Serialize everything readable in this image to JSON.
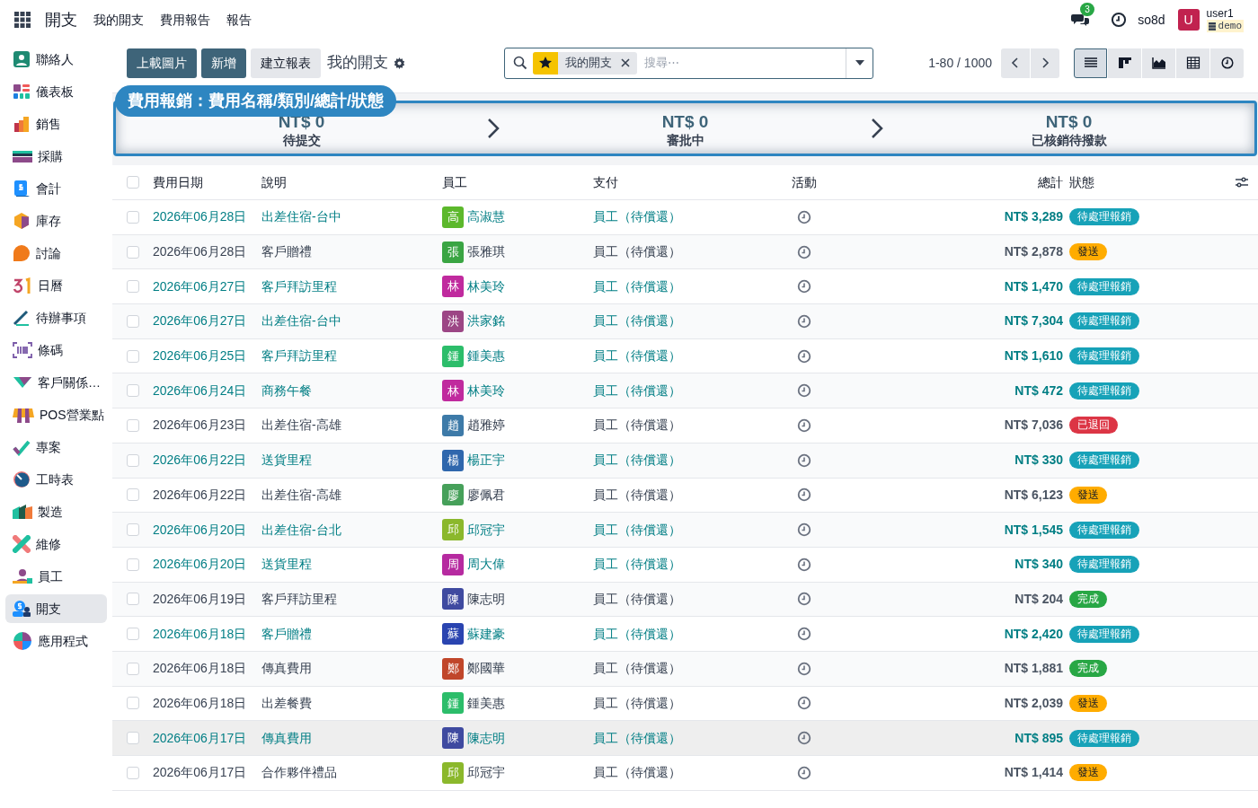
{
  "topbar": {
    "app_title": "開支",
    "menu": [
      "我的開支",
      "費用報告",
      "報告"
    ],
    "messages_count": "3",
    "company": "so8d",
    "user_initial": "U",
    "user_name": "user1",
    "database": "demo"
  },
  "sidebar": {
    "items": [
      {
        "label": "聯絡人",
        "selected": false
      },
      {
        "label": "儀表板",
        "selected": false
      },
      {
        "label": "銷售",
        "selected": false
      },
      {
        "label": "採購",
        "selected": false
      },
      {
        "label": "會計",
        "selected": false
      },
      {
        "label": "庫存",
        "selected": false
      },
      {
        "label": "討論",
        "selected": false
      },
      {
        "label": "日曆",
        "selected": false
      },
      {
        "label": "待辦事項",
        "selected": false
      },
      {
        "label": "條碼",
        "selected": false
      },
      {
        "label": "客戶關係…",
        "selected": false
      },
      {
        "label": "POS營業點",
        "selected": false
      },
      {
        "label": "專案",
        "selected": false
      },
      {
        "label": "工時表",
        "selected": false
      },
      {
        "label": "製造",
        "selected": false
      },
      {
        "label": "維修",
        "selected": false
      },
      {
        "label": "員工",
        "selected": false
      },
      {
        "label": "開支",
        "selected": true
      },
      {
        "label": "應用程式",
        "selected": false
      }
    ]
  },
  "control_panel": {
    "buttons": [
      {
        "label": "上載圖片",
        "kind": "primary"
      },
      {
        "label": "新增",
        "kind": "primary"
      },
      {
        "label": "建立報表",
        "kind": "secondary"
      }
    ],
    "breadcrumb": "我的開支",
    "search": {
      "facet": "我的開支",
      "placeholder": "搜尋⋯"
    },
    "pager": "1-80 / 1000",
    "views": [
      {
        "selected": true
      },
      {
        "selected": false
      },
      {
        "selected": false
      },
      {
        "selected": false
      },
      {
        "selected": false
      }
    ]
  },
  "tooltip": "費用報銷：費用名稱/類別/總計/狀態",
  "stages": [
    {
      "amount": "NT$ 0",
      "label": "待提交"
    },
    {
      "amount": "NT$ 0",
      "label": "審批中"
    },
    {
      "amount": "NT$ 0",
      "label": "已核銷待撥款"
    }
  ],
  "table": {
    "select_all_checked": false,
    "columns": [
      "費用日期",
      "說明",
      "員工",
      "支付",
      "活動",
      "總計",
      "狀態"
    ],
    "rows": [
      {
        "checked": false,
        "highlighted": false,
        "date": "2026年06月28日",
        "description": "出差住宿-台中",
        "avatar": {
          "initial": "高",
          "color": "#5cb82c"
        },
        "employee": "高淑慧",
        "payment": "員工（待償還）",
        "total": "NT$ 3,289",
        "status": {
          "label": "待處理報銷",
          "kind": "approve"
        }
      },
      {
        "checked": false,
        "highlighted": false,
        "date": "2026年06月28日",
        "description": "客戶贈禮",
        "avatar": {
          "initial": "張",
          "color": "#3aa543"
        },
        "employee": "張雅琪",
        "payment": "員工（待償還）",
        "total": "NT$ 2,878",
        "status": {
          "label": "發送",
          "kind": "submitted"
        }
      },
      {
        "checked": false,
        "highlighted": false,
        "date": "2026年06月27日",
        "description": "客戶拜訪里程",
        "avatar": {
          "initial": "林",
          "color": "#c02a9e"
        },
        "employee": "林美玲",
        "payment": "員工（待償還）",
        "total": "NT$ 1,470",
        "status": {
          "label": "待處理報銷",
          "kind": "approve"
        }
      },
      {
        "checked": false,
        "highlighted": false,
        "date": "2026年06月27日",
        "description": "出差住宿-台中",
        "avatar": {
          "initial": "洪",
          "color": "#9c4685"
        },
        "employee": "洪家銘",
        "payment": "員工（待償還）",
        "total": "NT$ 7,304",
        "status": {
          "label": "待處理報銷",
          "kind": "approve"
        }
      },
      {
        "checked": false,
        "highlighted": false,
        "date": "2026年06月25日",
        "description": "客戶拜訪里程",
        "avatar": {
          "initial": "鍾",
          "color": "#2cbd6a"
        },
        "employee": "鍾美惠",
        "payment": "員工（待償還）",
        "total": "NT$ 1,610",
        "status": {
          "label": "待處理報銷",
          "kind": "approve"
        }
      },
      {
        "checked": false,
        "highlighted": false,
        "date": "2026年06月24日",
        "description": "商務午餐",
        "avatar": {
          "initial": "林",
          "color": "#c02a9e"
        },
        "employee": "林美玲",
        "payment": "員工（待償還）",
        "total": "NT$ 472",
        "status": {
          "label": "待處理報銷",
          "kind": "approve"
        }
      },
      {
        "checked": false,
        "highlighted": false,
        "date": "2026年06月23日",
        "description": "出差住宿-高雄",
        "avatar": {
          "initial": "趙",
          "color": "#3d7aa8"
        },
        "employee": "趙雅婷",
        "payment": "員工（待償還）",
        "total": "NT$ 7,036",
        "status": {
          "label": "已退回",
          "kind": "refused"
        }
      },
      {
        "checked": false,
        "highlighted": false,
        "date": "2026年06月22日",
        "description": "送貨里程",
        "avatar": {
          "initial": "楊",
          "color": "#2f67ad"
        },
        "employee": "楊正宇",
        "payment": "員工（待償還）",
        "total": "NT$ 330",
        "status": {
          "label": "待處理報銷",
          "kind": "approve"
        }
      },
      {
        "checked": false,
        "highlighted": false,
        "date": "2026年06月22日",
        "description": "出差住宿-高雄",
        "avatar": {
          "initial": "廖",
          "color": "#46a05a"
        },
        "employee": "廖佩君",
        "payment": "員工（待償還）",
        "total": "NT$ 6,123",
        "status": {
          "label": "發送",
          "kind": "submitted"
        }
      },
      {
        "checked": false,
        "highlighted": false,
        "date": "2026年06月20日",
        "description": "出差住宿-台北",
        "avatar": {
          "initial": "邱",
          "color": "#8bb82c"
        },
        "employee": "邱冠宇",
        "payment": "員工（待償還）",
        "total": "NT$ 1,545",
        "status": {
          "label": "待處理報銷",
          "kind": "approve"
        }
      },
      {
        "checked": false,
        "highlighted": false,
        "date": "2026年06月20日",
        "description": "送貨里程",
        "avatar": {
          "initial": "周",
          "color": "#b62aa0"
        },
        "employee": "周大偉",
        "payment": "員工（待償還）",
        "total": "NT$ 340",
        "status": {
          "label": "待處理報銷",
          "kind": "approve"
        }
      },
      {
        "checked": false,
        "highlighted": false,
        "date": "2026年06月19日",
        "description": "客戶拜訪里程",
        "avatar": {
          "initial": "陳",
          "color": "#3f4aa0"
        },
        "employee": "陳志明",
        "payment": "員工（待償還）",
        "total": "NT$ 204",
        "status": {
          "label": "完成",
          "kind": "done"
        }
      },
      {
        "checked": false,
        "highlighted": false,
        "date": "2026年06月18日",
        "description": "客戶贈禮",
        "avatar": {
          "initial": "蘇",
          "color": "#2a44b0"
        },
        "employee": "蘇建豪",
        "payment": "員工（待償還）",
        "total": "NT$ 2,420",
        "status": {
          "label": "待處理報銷",
          "kind": "approve"
        }
      },
      {
        "checked": false,
        "highlighted": false,
        "date": "2026年06月18日",
        "description": "傳真費用",
        "avatar": {
          "initial": "鄭",
          "color": "#c0462a"
        },
        "employee": "鄭國華",
        "payment": "員工（待償還）",
        "total": "NT$ 1,881",
        "status": {
          "label": "完成",
          "kind": "done"
        }
      },
      {
        "checked": false,
        "highlighted": false,
        "date": "2026年06月18日",
        "description": "出差餐費",
        "avatar": {
          "initial": "鍾",
          "color": "#2cbd6a"
        },
        "employee": "鍾美惠",
        "payment": "員工（待償還）",
        "total": "NT$ 2,039",
        "status": {
          "label": "發送",
          "kind": "submitted"
        }
      },
      {
        "checked": false,
        "highlighted": true,
        "date": "2026年06月17日",
        "description": "傳真費用",
        "avatar": {
          "initial": "陳",
          "color": "#3f4aa0"
        },
        "employee": "陳志明",
        "payment": "員工（待償還）",
        "total": "NT$ 895",
        "status": {
          "label": "待處理報銷",
          "kind": "approve"
        }
      },
      {
        "checked": false,
        "highlighted": false,
        "date": "2026年06月17日",
        "description": "合作夥伴禮品",
        "avatar": {
          "initial": "邱",
          "color": "#8bb82c"
        },
        "employee": "邱冠宇",
        "payment": "員工（待償還）",
        "total": "NT$ 1,414",
        "status": {
          "label": "發送",
          "kind": "submitted"
        }
      }
    ]
  }
}
